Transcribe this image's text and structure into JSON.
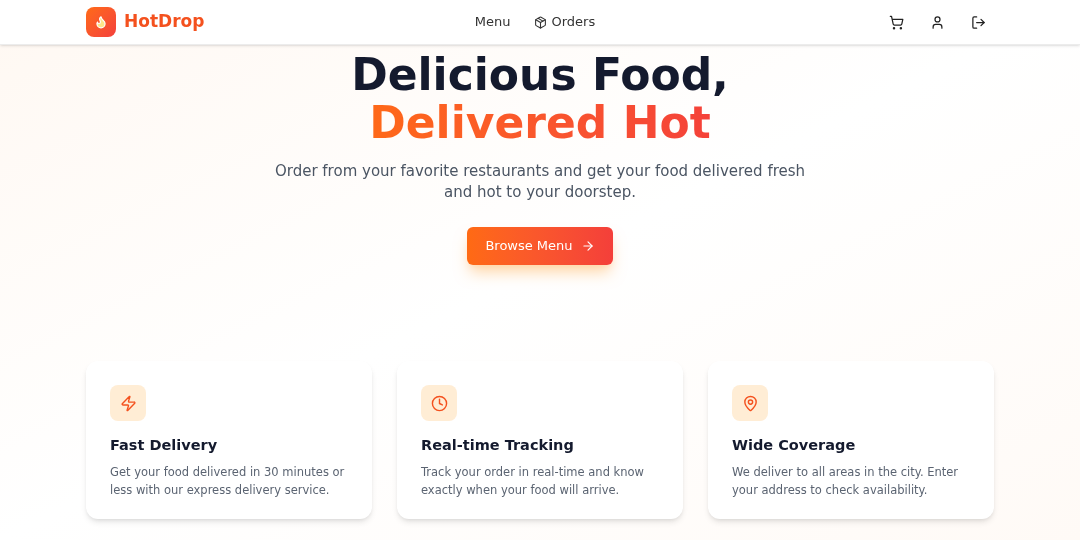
{
  "header": {
    "brand": "HotDrop",
    "nav": [
      {
        "label": "Menu",
        "kind": "plain"
      },
      {
        "label": "Orders",
        "kind": "package"
      }
    ],
    "actions": [
      {
        "kind": "cart"
      },
      {
        "kind": "user"
      },
      {
        "kind": "logout"
      }
    ]
  },
  "hero": {
    "title_line_1": "Delicious Food,",
    "title_line_2": "Delivered Hot",
    "subtitle": "Order from your favorite restaurants and get your food delivered fresh and hot to your doorstep.",
    "cta": "Browse Menu"
  },
  "features": [
    {
      "kind": "bolt",
      "title": "Fast Delivery",
      "text": "Get your food delivered in 30 minutes or less with our express delivery service."
    },
    {
      "kind": "clock",
      "title": "Real-time Tracking",
      "text": "Track your order in real-time and know exactly when your food will arrive."
    },
    {
      "kind": "pin",
      "title": "Wide Coverage",
      "text": "We deliver to all areas in the city. Enter your address to check availability."
    }
  ]
}
